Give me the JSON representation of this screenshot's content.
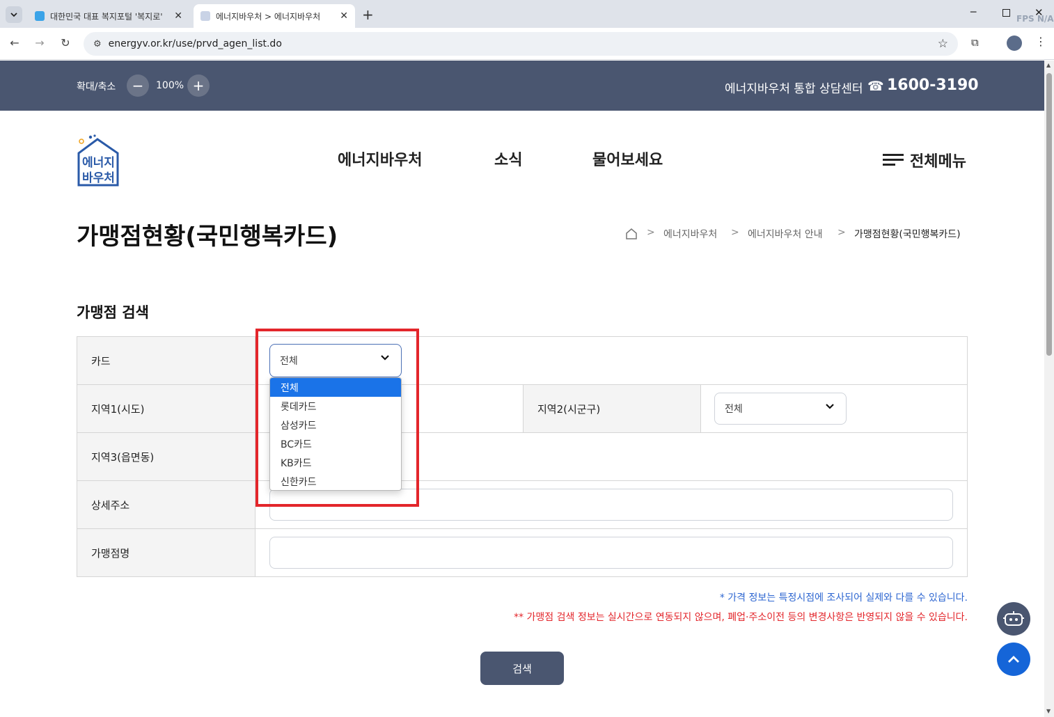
{
  "browser": {
    "tabs": [
      {
        "title": "대한민국 대표 복지포털 '복지로'"
      },
      {
        "title": "에너지바우처 > 에너지바우처"
      }
    ],
    "url": "energyv.or.kr/use/prvd_agen_list.do",
    "fps_label": "FPS",
    "fps_value": "N/A"
  },
  "utility": {
    "zoom_label": "확대/축소",
    "zoom_value": "100%",
    "call_center_label": "에너지바우처 통합 상담센터",
    "phone": "1600-3190"
  },
  "header": {
    "logo_line1": "에너지",
    "logo_line2": "바우처",
    "nav": [
      "에너지바우처",
      "소식",
      "물어보세요"
    ],
    "all_menu": "전체메뉴"
  },
  "page": {
    "title": "가맹점현황(국민행복카드)",
    "breadcrumb": [
      "에너지바우처",
      "에너지바우처 안내",
      "가맹점현황(국민행복카드)"
    ],
    "section_title": "가맹점 검색"
  },
  "form": {
    "card_label": "카드",
    "card_value": "전체",
    "card_options": [
      "전체",
      "롯데카드",
      "삼성카드",
      "BC카드",
      "KB카드",
      "신한카드"
    ],
    "region1_label": "지역1(시도)",
    "region2_label": "지역2(시군구)",
    "region2_value": "전체",
    "region3_label": "지역3(읍면동)",
    "address_label": "상세주소",
    "store_label": "가맹점명"
  },
  "notes": {
    "blue": "* 가격 정보는 특정시점에 조사되어 실제와 다를 수 있습니다.",
    "red": "** 가맹점 검색 정보는 실시간으로 연동되지 않으며, 폐업·주소이전 등의 변경사항은 반영되지 않을 수 있습니다."
  },
  "search_button": "검색",
  "colors": {
    "header_bg": "#4a5670",
    "highlight": "#e3262b",
    "accent_blue": "#1a73e8",
    "fab_blue": "#1565d8"
  }
}
